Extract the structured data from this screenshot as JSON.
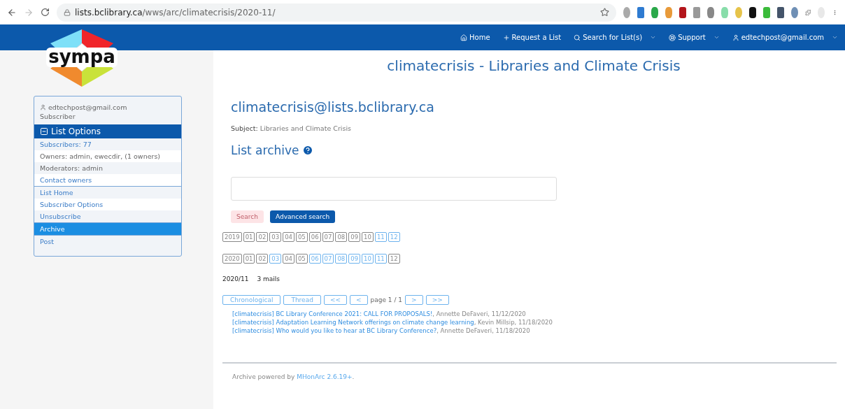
{
  "browser": {
    "url_host": "lists.bclibrary.ca",
    "url_path": "/wws/arc/climatecrisis/2020-11/"
  },
  "logo": {
    "text": "sympa"
  },
  "nav": [
    {
      "kind": "home",
      "label": "Home",
      "dropdown": false
    },
    {
      "kind": "plus",
      "label": "Request a List",
      "dropdown": false
    },
    {
      "kind": "search",
      "label": "Search for List(s)",
      "dropdown": true
    },
    {
      "kind": "support",
      "label": "Support",
      "dropdown": true
    },
    {
      "kind": "user",
      "label": "edtechpost@gmail.com",
      "dropdown": true
    }
  ],
  "page_title": "climatecrisis - Libraries and Climate Crisis",
  "sidebar": {
    "user": "edtechpost@gmail.com",
    "role": "Subscriber",
    "options_title": "List Options",
    "info": [
      {
        "label": "Subscribers: 77",
        "link": true
      },
      {
        "label": "Owners: admin, ewecdir, (1 owners)",
        "link": false
      },
      {
        "label": "Moderators: admin",
        "link": false
      },
      {
        "label": "Contact owners",
        "link": true
      }
    ],
    "items": [
      {
        "label": "List Home",
        "selected": false
      },
      {
        "label": "Subscriber Options",
        "selected": false
      },
      {
        "label": "Unsubscribe",
        "selected": false
      },
      {
        "label": "Archive",
        "selected": true
      },
      {
        "label": "Post",
        "selected": false
      }
    ]
  },
  "list_address": "climatecrisis@lists.bclibrary.ca",
  "subject_label": "Subject:",
  "subject": "Libraries and Climate Crisis",
  "archive_title": "List archive",
  "search_button": {
    "label": "Search",
    "disabled": true
  },
  "advanced_button": "Advanced search",
  "years": [
    {
      "year": "2019",
      "months": [
        {
          "label": "01",
          "active": false
        },
        {
          "label": "02",
          "active": false
        },
        {
          "label": "03",
          "active": false
        },
        {
          "label": "04",
          "active": false
        },
        {
          "label": "05",
          "active": false
        },
        {
          "label": "06",
          "active": false
        },
        {
          "label": "07",
          "active": false
        },
        {
          "label": "08",
          "active": false
        },
        {
          "label": "09",
          "active": false
        },
        {
          "label": "10",
          "active": false
        },
        {
          "label": "11",
          "active": true
        },
        {
          "label": "12",
          "active": true
        }
      ]
    },
    {
      "year": "2020",
      "months": [
        {
          "label": "01",
          "active": false
        },
        {
          "label": "02",
          "active": false
        },
        {
          "label": "03",
          "active": true
        },
        {
          "label": "04",
          "active": false
        },
        {
          "label": "05",
          "active": false
        },
        {
          "label": "06",
          "active": true
        },
        {
          "label": "07",
          "active": true
        },
        {
          "label": "08",
          "active": true
        },
        {
          "label": "09",
          "active": true
        },
        {
          "label": "10",
          "active": true
        },
        {
          "label": "11",
          "active": true
        },
        {
          "label": "12",
          "active": false
        }
      ]
    }
  ],
  "period": "2020/11",
  "mail_count": "3 mails",
  "view_buttons": [
    "Chronological",
    "Thread"
  ],
  "pager": {
    "first": "<<",
    "prev": "<",
    "text": "page 1 / 1",
    "next": ">",
    "last": ">>"
  },
  "messages": [
    {
      "subject": "[climatecrisis] BC Library Conference 2021: CALL FOR PROPOSALS!",
      "meta": ", Annette DeFaveri, 11/12/2020"
    },
    {
      "subject": "[climatecrisis] Adaptation Learning Network offerings on climate change learning",
      "meta": ", Kevin Millsip, 11/18/2020"
    },
    {
      "subject": "[climatecrisis] Who would you like to hear at BC Library Conference?",
      "meta": ", Annette DeFaveri, 11/18/2020"
    }
  ],
  "footer": {
    "text": "Archive powered by",
    "link": "MHonArc 2.6.19+",
    "end": "."
  }
}
